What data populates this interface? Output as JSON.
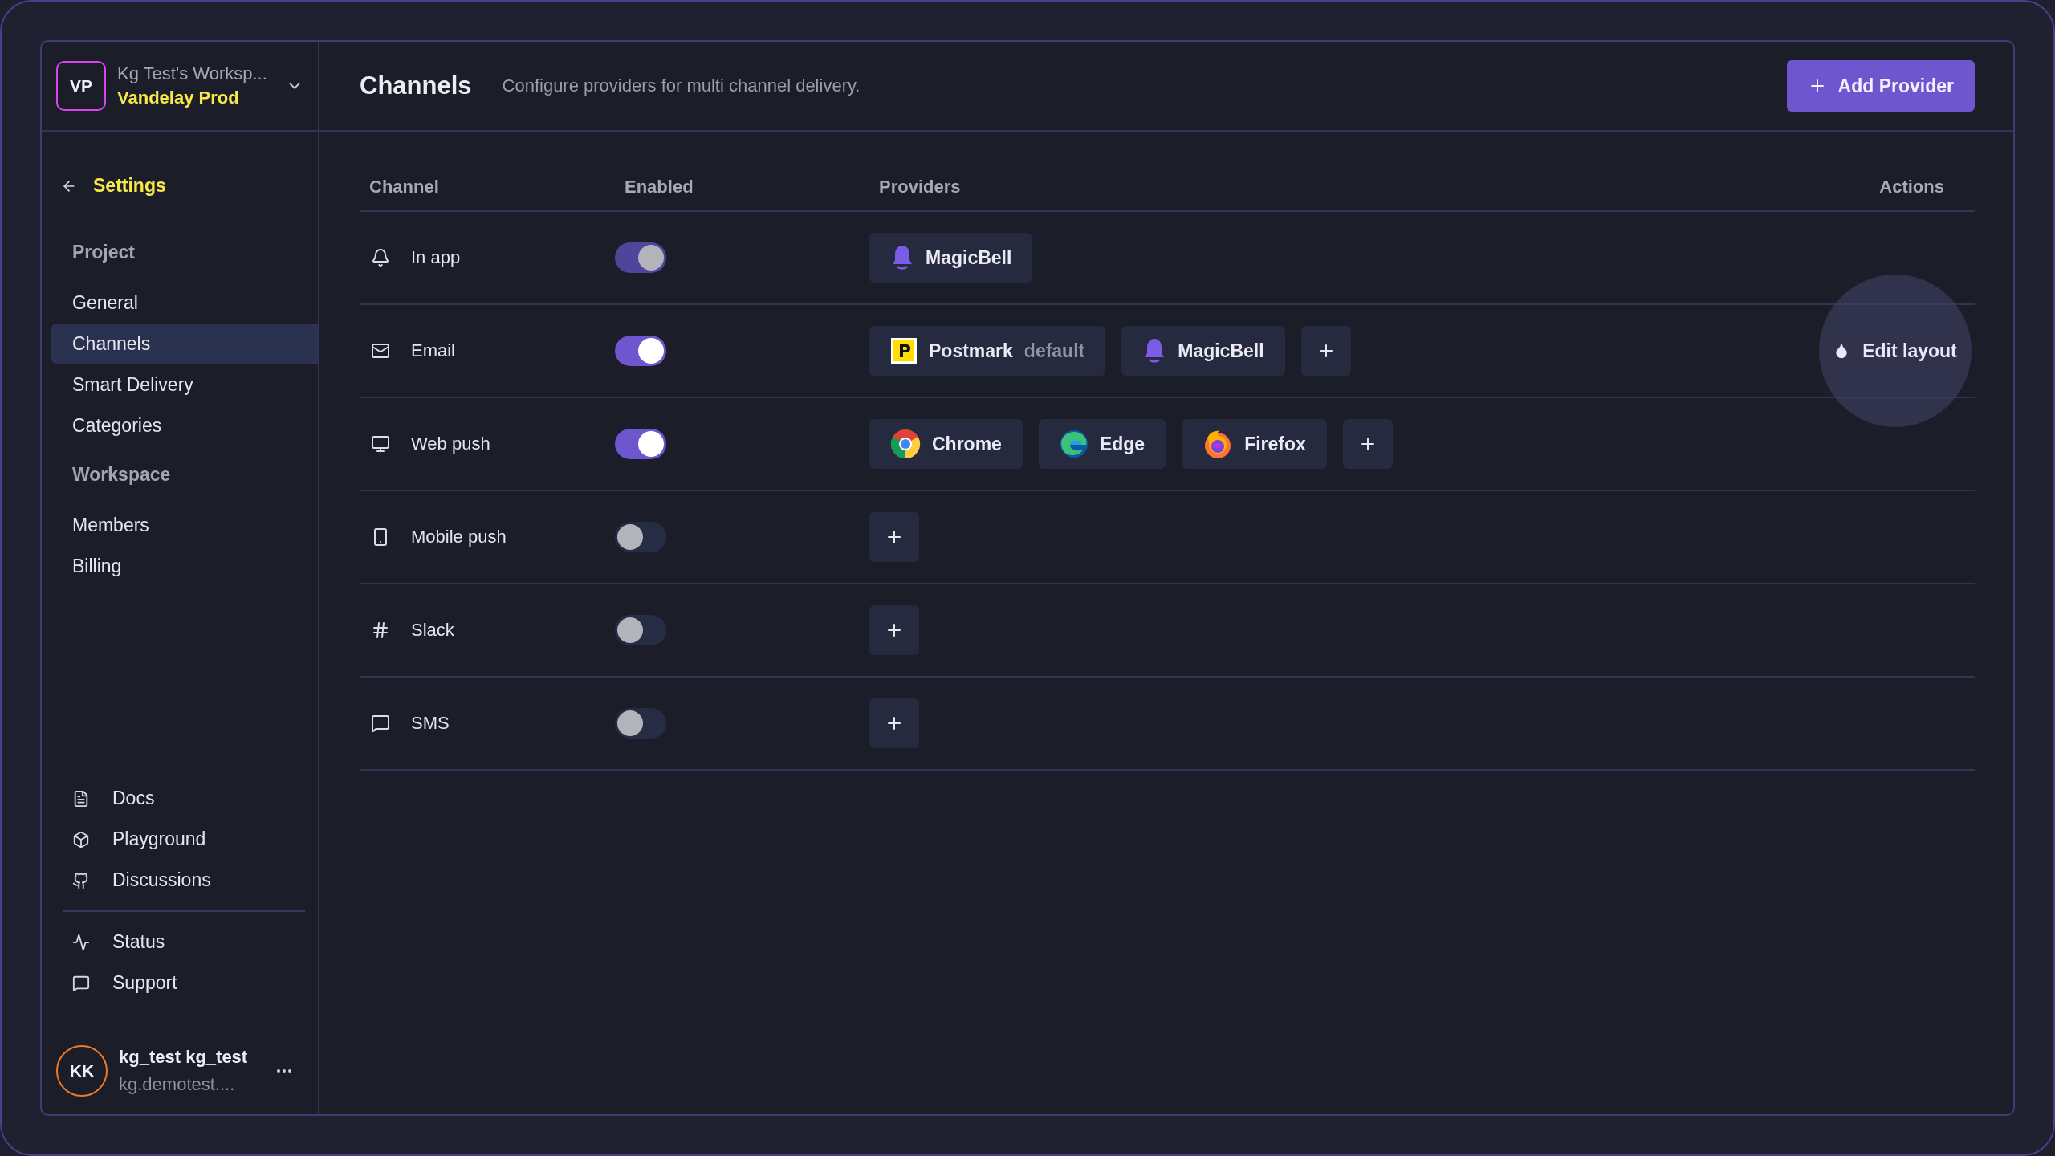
{
  "workspace": {
    "initials": "VP",
    "name": "Kg Test's Worksp...",
    "project": "Vandelay Prod"
  },
  "header": {
    "title": "Channels",
    "description": "Configure providers for multi channel delivery.",
    "action": "Add Provider"
  },
  "sidebar": {
    "back": "Settings",
    "sections": [
      {
        "title": "Project",
        "items": [
          {
            "label": "General",
            "selected": false
          },
          {
            "label": "Channels",
            "selected": true
          },
          {
            "label": "Smart Delivery",
            "selected": false
          },
          {
            "label": "Categories",
            "selected": false
          }
        ]
      },
      {
        "title": "Workspace",
        "items": [
          {
            "label": "Members",
            "selected": false
          },
          {
            "label": "Billing",
            "selected": false
          }
        ]
      }
    ],
    "links": [
      {
        "label": "Docs",
        "kind": "docs"
      },
      {
        "label": "Playground",
        "kind": "playground"
      },
      {
        "label": "Discussions",
        "kind": "discussions"
      }
    ],
    "help": [
      {
        "label": "Status",
        "kind": "status"
      },
      {
        "label": "Support",
        "kind": "support"
      }
    ],
    "user": {
      "initials": "KK",
      "name": "kg_test kg_test",
      "email": "kg.demotest...."
    }
  },
  "table": {
    "columns": [
      "Channel",
      "Enabled",
      "Providers",
      "Actions"
    ],
    "rows": [
      {
        "kind": "bell",
        "name": "In app",
        "enabled": true,
        "disabled": true,
        "providers": [
          {
            "kind": "magicbell",
            "name": "MagicBell"
          }
        ]
      },
      {
        "kind": "mail",
        "name": "Email",
        "enabled": true,
        "disabled": false,
        "providers": [
          {
            "kind": "postmark",
            "name": "Postmark",
            "tag": "default"
          },
          {
            "kind": "magicbell",
            "name": "MagicBell"
          },
          {
            "kind": "add"
          }
        ],
        "action": "Edit layout"
      },
      {
        "kind": "monitor",
        "name": "Web push",
        "enabled": true,
        "disabled": false,
        "providers": [
          {
            "kind": "chrome",
            "name": "Chrome"
          },
          {
            "kind": "edge",
            "name": "Edge"
          },
          {
            "kind": "firefox",
            "name": "Firefox"
          },
          {
            "kind": "add"
          }
        ]
      },
      {
        "kind": "phone",
        "name": "Mobile push",
        "enabled": false,
        "disabled": false,
        "providers": [
          {
            "kind": "add"
          }
        ]
      },
      {
        "kind": "hash",
        "name": "Slack",
        "enabled": false,
        "disabled": false,
        "providers": [
          {
            "kind": "add"
          }
        ]
      },
      {
        "kind": "chat",
        "name": "SMS",
        "enabled": false,
        "disabled": false,
        "providers": [
          {
            "kind": "add"
          }
        ]
      }
    ]
  }
}
